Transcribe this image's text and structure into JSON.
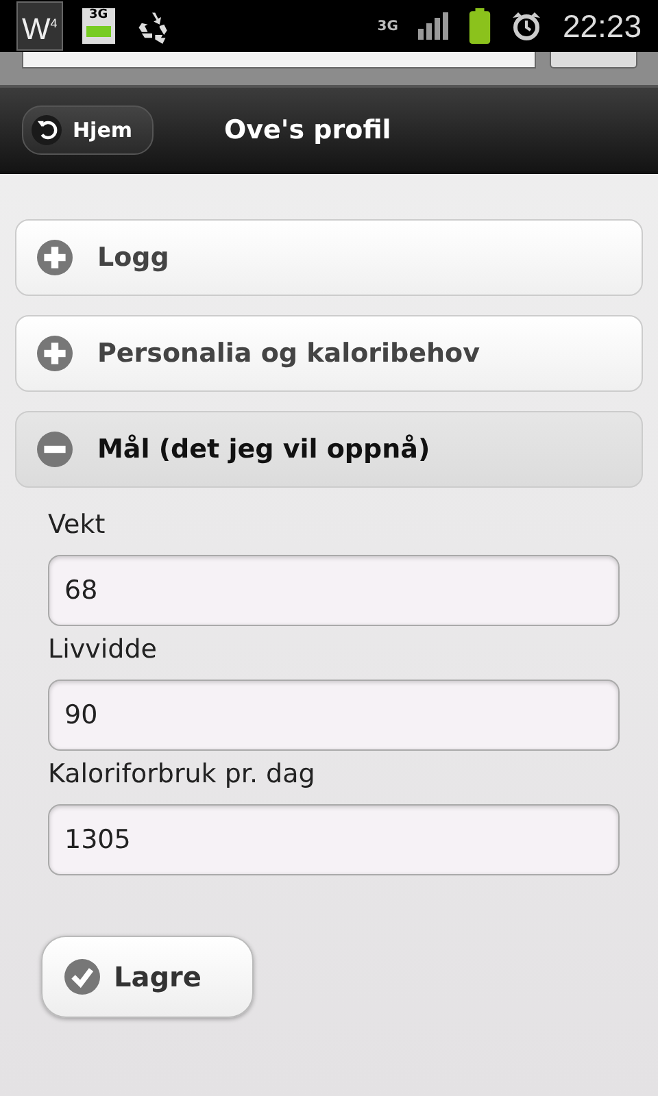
{
  "status_bar": {
    "notifications": [
      {
        "kind": "app",
        "label": "W",
        "sup": "4"
      },
      {
        "kind": "sim",
        "label": "3G"
      },
      {
        "kind": "recycle"
      }
    ],
    "network": "3G",
    "time": "22:23"
  },
  "header": {
    "back_button": "Hjem",
    "title": "Ove's profil"
  },
  "sections": [
    {
      "title": "Logg",
      "expanded": false
    },
    {
      "title": "Personalia og kaloribehov",
      "expanded": false
    },
    {
      "title": "Mål (det jeg vil oppnå)",
      "expanded": true,
      "fields": [
        {
          "label": "Vekt",
          "value": "68"
        },
        {
          "label": "Livvidde",
          "value": "90"
        },
        {
          "label": "Kaloriforbruk pr. dag",
          "value": "1305"
        }
      ]
    }
  ],
  "save_button": "Lagre"
}
